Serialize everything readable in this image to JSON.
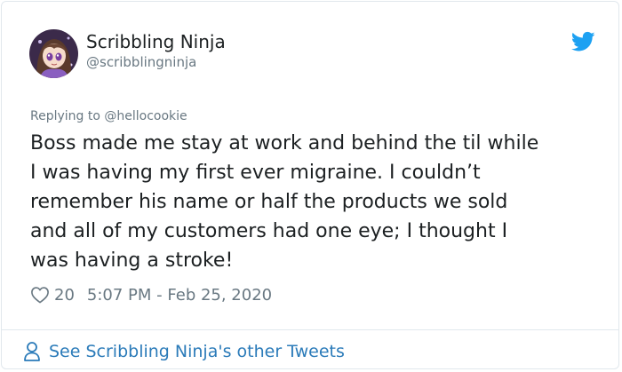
{
  "author": {
    "name": "Scribbling Ninja",
    "handle": "@scribblingninja",
    "avatar_icon": "anime-girl-avatar"
  },
  "brand": {
    "icon": "twitter-bird-icon",
    "color": "#1da1f2"
  },
  "reply": {
    "prefix": "Replying to ",
    "to": "@hellocookie"
  },
  "tweet": {
    "lines": [
      "Boss made me stay at work and behind the til while",
      "I was having my first ever migraine. I couldn’t",
      "remember his name or half the products we sold",
      "and all of my customers had one eye; I thought I",
      "was having a stroke!"
    ]
  },
  "meta": {
    "likes": "20",
    "timestamp": "5:07 PM - Feb 25, 2020"
  },
  "footer": {
    "label": "See Scribbling Ninja's other Tweets",
    "link_color": "#2b7bb9"
  }
}
